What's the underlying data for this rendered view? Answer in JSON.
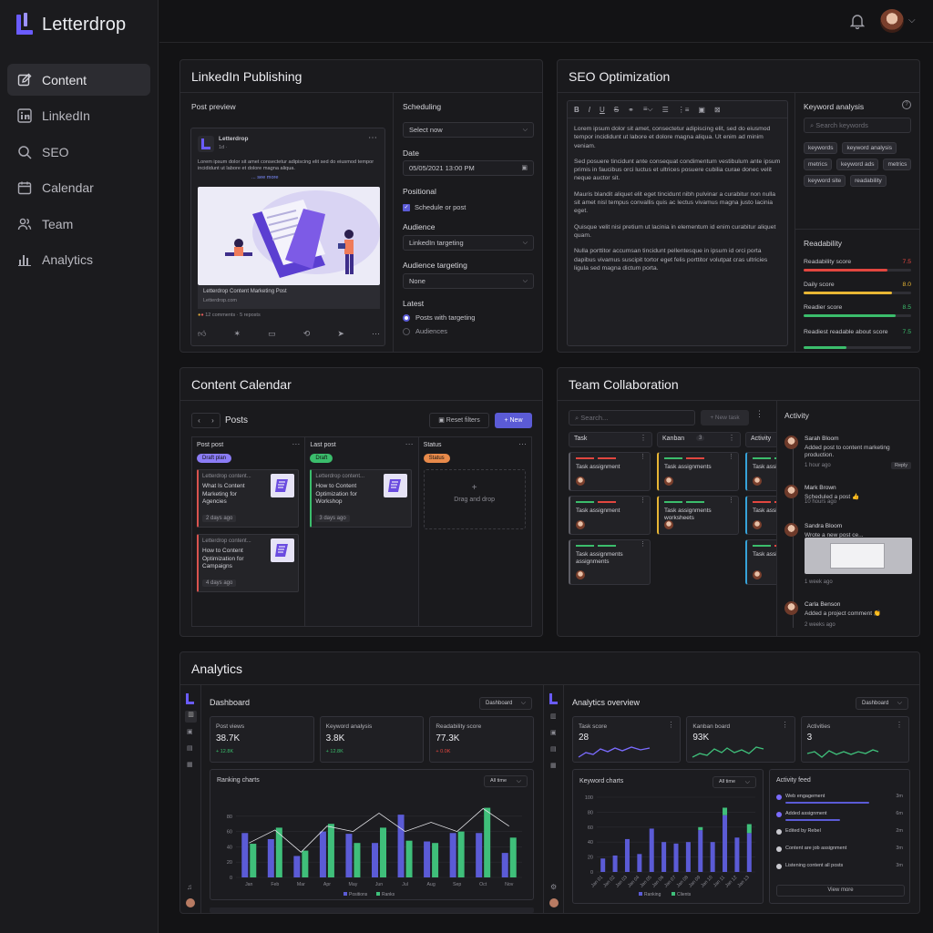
{
  "brand": {
    "name": "Letterdrop",
    "accent": "#6a5cff"
  },
  "nav": [
    {
      "label": "Content",
      "icon": "edit-icon",
      "active": true
    },
    {
      "label": "LinkedIn",
      "icon": "linkedin-icon"
    },
    {
      "label": "SEO",
      "icon": "search-icon"
    },
    {
      "label": "Calendar",
      "icon": "calendar-icon"
    },
    {
      "label": "Team",
      "icon": "team-icon"
    },
    {
      "label": "Analytics",
      "icon": "analytics-icon"
    }
  ],
  "linkedin": {
    "title": "LinkedIn Publishing",
    "preview_label": "Post preview",
    "post_author": "Letterdrop",
    "post_meta": "1d ·",
    "post_text": "Lorem ipsum dolor sit amet consectetur adipiscing elit sed do eiusmod tempor incididunt ut labore et dolore magna aliqua.",
    "see_more": "... see more",
    "image_caption_title": "Letterdrop Content Marketing Post",
    "image_caption_sub": "Letterdrop.com",
    "reactions": "12 comments · 5 reposts",
    "scheduling_label": "Scheduling",
    "scheduling_value": "Select now",
    "date_label": "Date",
    "date_value": "05/05/2021 13:00 PM",
    "positional_label": "Positional",
    "checkbox_label": "Schedule or post",
    "audience_label": "Audience",
    "audience_value": "LinkedIn targeting",
    "targeting_label": "Audience targeting",
    "targeting_value": "None",
    "latest_label": "Latest",
    "radio1": "Posts with targeting",
    "radio2": "Audiences"
  },
  "seo": {
    "title": "SEO Optimization",
    "paragraphs": [
      "Lorem ipsum dolor sit amet, consectetur adipiscing elit, sed do eiusmod tempor incididunt ut labore et dolore magna aliqua. Ut enim ad minim veniam.",
      "Sed posuere tincidunt ante consequat condimentum vestibulum ante ipsum primis in faucibus orci luctus et ultrices posuere cubilia curae donec velit neque auctor sit.",
      "Mauris blandit aliquet elit eget tincidunt nibh pulvinar a curabitur non nulla sit amet nisl tempus convallis quis ac lectus vivamus magna justo lacinia eget.",
      "Quisque velit nisi pretium ut lacinia in elementum id enim curabitur aliquet quam.",
      "Nulla porttitor accumsan tincidunt pellentesque in ipsum id orci porta dapibus vivamus suscipit tortor eget felis porttitor volutpat cras ultricies ligula sed magna dictum porta."
    ],
    "keyword_title": "Keyword analysis",
    "search_placeholder": "Search keywords",
    "keywords": [
      "keywords",
      "keyword analysis",
      "metrics",
      "keyword ads",
      "metrics",
      "keyword site",
      "readability"
    ],
    "readability_title": "Readability",
    "scores": [
      {
        "label": "Readability score",
        "value": "7.5",
        "color": "#e2463f",
        "fill": 0.78
      },
      {
        "label": "Daily score",
        "value": "8.0",
        "color": "#e8b634",
        "fill": 0.82
      },
      {
        "label": "Readier score",
        "value": "8.5",
        "color": "#3bbd6c",
        "fill": 0.86
      },
      {
        "label": "Readiest readable about score",
        "value": "7.5",
        "color": "#3bbd6c",
        "fill": 0.4
      }
    ]
  },
  "calendar": {
    "title": "Content Calendar",
    "nav_label": "Posts",
    "filter_label": "Reset filters",
    "new_label": "+ New",
    "columns": [
      {
        "title": "Post post",
        "tag": "Draft plan",
        "tag_color": "#8b7cf6",
        "cards": [
          {
            "src": "Letterdrop content...",
            "title": "What Is Content Marketing for Agencies",
            "date": "2 days ago",
            "accent": "#d9534f"
          },
          {
            "src": "Letterdrop content...",
            "title": "How to Content Optimization for Campaigns",
            "date": "4 days ago",
            "accent": "#d9534f"
          }
        ]
      },
      {
        "title": "Last post",
        "tag": "Draft",
        "tag_color": "#3bbd6c",
        "cards": [
          {
            "src": "Letterdrop content...",
            "title": "How to Content Optimization for Workshop",
            "date": "3 days ago",
            "accent": "#3bbd6c"
          }
        ]
      },
      {
        "title": "Status",
        "tag": "Status",
        "tag_color": "#e88a4a",
        "cards": []
      }
    ],
    "drop_label": "Drag and drop"
  },
  "team": {
    "title": "Team Collaboration",
    "search_placeholder": "Search...",
    "new_task": "+ New task",
    "cols": [
      {
        "title": "Task",
        "cards": [
          "Task assignment",
          "Task assignment",
          "Task assignments assignments"
        ]
      },
      {
        "title": "Kanban",
        "count": "3",
        "cards": [
          "Task assignments",
          "Task assignments worksheets"
        ]
      },
      {
        "title": "Activity",
        "cards": [
          "Task assig...",
          "Task assig...",
          "Task assig..."
        ]
      }
    ],
    "activity_title": "Activity",
    "activity": [
      {
        "name": "Sarah Bloom",
        "text": "Added post to content marketing production.",
        "time": "1 hour ago",
        "reply": "Reply"
      },
      {
        "name": "Mark Brown",
        "text": "Scheduled a post 👍",
        "time": "10 hours ago"
      },
      {
        "name": "Sandra Bloom",
        "text": "Wrote a new post ce...",
        "time": "1 week ago"
      },
      {
        "name": "Carla Benson",
        "text": "Added a project comment 👏",
        "time": "2 weeks ago"
      }
    ]
  },
  "analytics": {
    "title": "Analytics",
    "left": {
      "title": "Dashboard",
      "dropdown": "Dashboard",
      "stats": [
        {
          "label": "Post views",
          "value": "38.7K",
          "delta": "+ 12.8K",
          "color": "#3bbd6c"
        },
        {
          "label": "Keyword analysis",
          "value": "3.8K",
          "delta": "+ 12.8K",
          "color": "#3bbd6c"
        },
        {
          "label": "Readability score",
          "value": "77.3K",
          "delta": "+ 0.0K",
          "color": "#e2463f"
        }
      ],
      "chart_title": "Ranking charts",
      "chart_dropdown": "All time"
    },
    "right": {
      "title": "Analytics overview",
      "dropdown": "Dashboard",
      "stats": [
        {
          "label": "Task score",
          "value": "28"
        },
        {
          "label": "Kanban board",
          "value": "93K"
        },
        {
          "label": "Activities",
          "value": "3"
        }
      ],
      "chart_title": "Keyword charts",
      "chart_dropdown": "All time",
      "feed_title": "Activity feed",
      "feed": [
        {
          "label": "Web engagement",
          "time": "3m"
        },
        {
          "label": "Added assignment",
          "time": "6m"
        },
        {
          "label": "Edited by Rebel",
          "time": "2m"
        },
        {
          "label": "Content are job assignment",
          "time": "3m"
        },
        {
          "label": "Listening content all posts",
          "time": "3m"
        }
      ],
      "view_more": "View more"
    }
  },
  "chart_data": [
    {
      "type": "bar",
      "title": "Ranking charts",
      "categories": [
        "Jan",
        "Feb",
        "Mar",
        "Apr",
        "May",
        "Jun",
        "Jul",
        "Aug",
        "Sep",
        "Oct",
        "Nov"
      ],
      "ylim": [
        0,
        100
      ],
      "yticks": [
        0,
        20,
        40,
        60,
        80
      ],
      "series": [
        {
          "name": "Positions",
          "color": "#5b5bd6",
          "values": [
            58,
            50,
            28,
            60,
            57,
            45,
            82,
            47,
            58,
            58,
            32
          ]
        },
        {
          "name": "Ranks",
          "color": "#3fbf7a",
          "values": [
            44,
            65,
            35,
            70,
            45,
            65,
            48,
            45,
            60,
            91,
            52
          ]
        }
      ],
      "line": [
        45,
        62,
        33,
        67,
        60,
        84,
        60,
        72,
        60,
        90,
        67
      ]
    },
    {
      "type": "bar",
      "title": "Keyword charts",
      "categories": [
        "Jan 01",
        "Jan 02",
        "Jan 03",
        "Jan 04",
        "Jan 05",
        "Jan 06",
        "Jan 07",
        "Jan 08",
        "Jan 09",
        "Jan 10",
        "Jan 11",
        "Jan 12",
        "Jan 13"
      ],
      "yticks": [
        0,
        20,
        40,
        60,
        80,
        100
      ],
      "series": [
        {
          "name": "Ranking",
          "color": "#5b5bd6",
          "values": [
            18,
            22,
            44,
            24,
            58,
            40,
            38,
            40,
            56,
            40,
            76,
            46,
            52
          ]
        },
        {
          "name": "Clients",
          "color": "#3fbf7a",
          "values": [
            0,
            0,
            0,
            0,
            0,
            0,
            0,
            0,
            4,
            0,
            10,
            0,
            12
          ]
        }
      ]
    }
  ]
}
